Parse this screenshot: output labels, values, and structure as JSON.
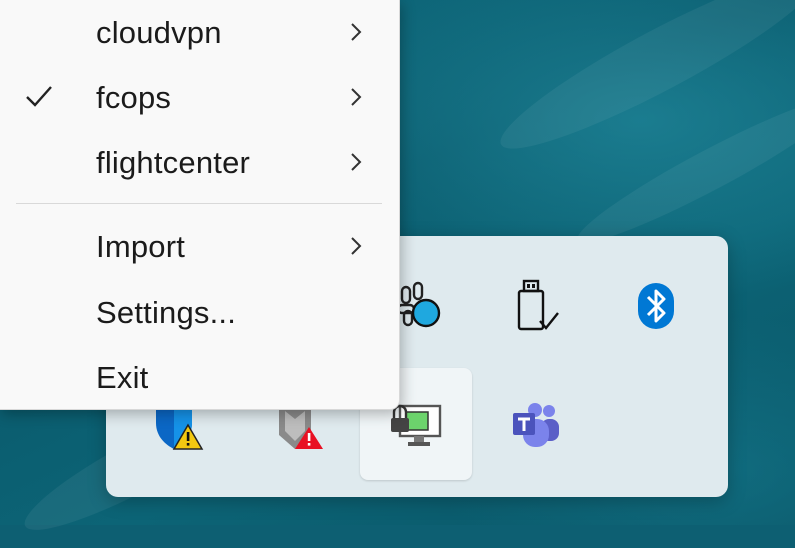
{
  "menu": {
    "items": [
      {
        "label": "cloudvpn",
        "checked": false,
        "submenu": true
      },
      {
        "label": "fcops",
        "checked": true,
        "submenu": true
      },
      {
        "label": "flightcenter",
        "checked": false,
        "submenu": true
      }
    ],
    "items2": [
      {
        "label": "Import",
        "submenu": true
      },
      {
        "label": "Settings...",
        "submenu": false
      },
      {
        "label": "Exit",
        "submenu": false
      }
    ]
  },
  "tray": {
    "icons": [
      "slack-icon",
      "usb-drive-icon",
      "bluetooth-icon",
      "windows-security-warning-icon",
      "mcafee-warning-icon",
      "vpn-network-icon",
      "teams-icon"
    ],
    "colors": {
      "bluetooth": "#0078d4",
      "warning": "#f2c811",
      "alert": "#e81123",
      "teams": "#5b5fc7",
      "vpn_green": "#6cd36c"
    }
  }
}
